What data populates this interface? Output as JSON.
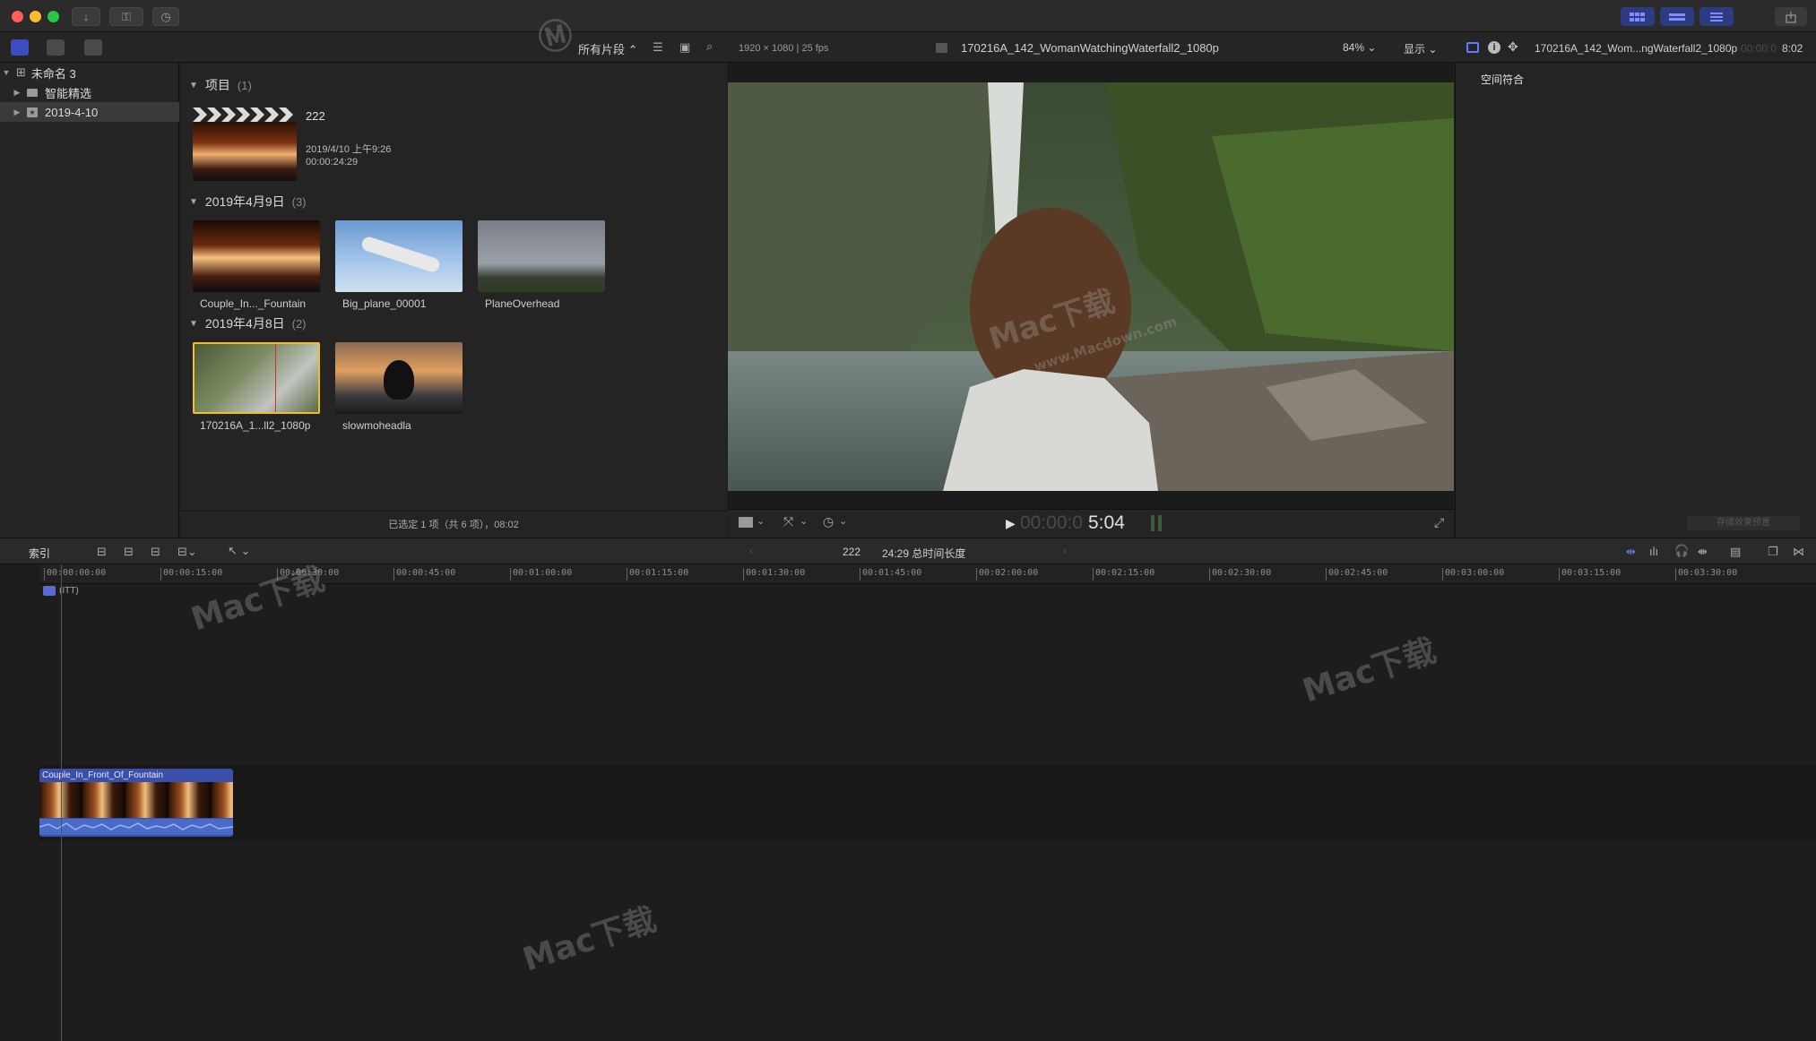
{
  "titlebar": {
    "nav_back_label": "↓",
    "key_label": "⚿",
    "clock_label": "◷"
  },
  "toolbar": {
    "filter_label": "所有片段 ⌃",
    "viewer_info": "1920 × 1080 | 25 fps",
    "clip_title": "170216A_142_WomanWatchingWaterfall2_1080p",
    "zoom_label": "84%",
    "display_label": "显示",
    "inspector_title": "170216A_142_Wom...ngWaterfall2_1080p",
    "inspector_duration_dim": "00:00:0",
    "inspector_duration": "8:02"
  },
  "sidebar": {
    "items": [
      {
        "label": "未命名 3",
        "icon": "grid-library-icon"
      },
      {
        "label": "智能精选",
        "icon": "folder-icon"
      },
      {
        "label": "2019-4-10",
        "icon": "event-star-icon"
      }
    ]
  },
  "browser": {
    "groups": [
      {
        "title": "项目",
        "count": "(1)"
      },
      {
        "title": "2019年4月9日",
        "count": "(3)"
      },
      {
        "title": "2019年4月8日",
        "count": "(2)"
      }
    ],
    "project": {
      "name": "222",
      "date": "2019/4/10 上午9:26",
      "duration": "00:00:24:29"
    },
    "clips_apr9": [
      "Couple_In..._Fountain",
      "Big_plane_00001",
      "PlaneOverhead"
    ],
    "clips_apr8": [
      "170216A_1...ll2_1080p",
      "slowmoheadla"
    ],
    "status": "已选定 1 项（共 6 项），08:02"
  },
  "viewer": {
    "timecode_dim": "00:00:0",
    "timecode": "5:04"
  },
  "inspector": {
    "field_label": "空间符合",
    "save_preset": "存储效果预置"
  },
  "timeline": {
    "index_label": "索引",
    "project_name": "222",
    "total_length": "24:29 总时间长度",
    "ruler": [
      "00:00:00:00",
      "00:00:15:00",
      "00:00:30:00",
      "00:00:45:00",
      "00:01:00:00",
      "00:01:15:00",
      "00:01:30:00",
      "00:01:45:00",
      "00:02:00:00",
      "00:02:15:00",
      "00:02:30:00",
      "00:02:45:00",
      "00:03:00:00",
      "00:03:15:00",
      "00:03:30:00"
    ],
    "track_marker": "(ITT)",
    "clip_name": "Couple_In_Front_Of_Fountain"
  },
  "watermark": {
    "text": "Mac下载",
    "url": "www.Macdown.com"
  }
}
